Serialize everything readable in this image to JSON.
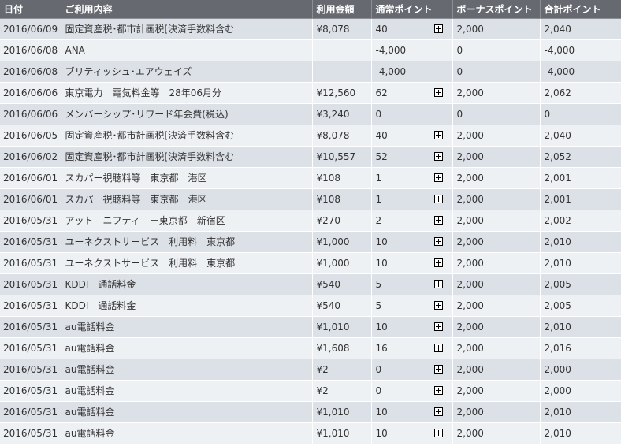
{
  "table": {
    "headers": {
      "date": "日付",
      "description": "ご利用内容",
      "amount": "利用金額",
      "regular_points": "通常ポイント",
      "bonus_points": "ボーナスポイント",
      "total_points": "合計ポイント"
    },
    "expand_icon": "plus-box-icon",
    "rows": [
      {
        "date": "2016/06/09",
        "description": "固定資産税･都市計画税[決済手数料含む",
        "amount": "¥8,078",
        "regular_points": "40",
        "expandable": true,
        "bonus_points": "2,000",
        "total_points": "2,040"
      },
      {
        "date": "2016/06/08",
        "description": "ANA",
        "amount": "",
        "regular_points": "-4,000",
        "expandable": false,
        "bonus_points": "0",
        "total_points": "-4,000"
      },
      {
        "date": "2016/06/08",
        "description": "ブリティッシュ･エアウェイズ",
        "amount": "",
        "regular_points": "-4,000",
        "expandable": false,
        "bonus_points": "0",
        "total_points": "-4,000"
      },
      {
        "date": "2016/06/06",
        "description": "東京電力　電気料金等　28年06月分",
        "amount": "¥12,560",
        "regular_points": "62",
        "expandable": true,
        "bonus_points": "2,000",
        "total_points": "2,062"
      },
      {
        "date": "2016/06/06",
        "description": "メンバーシップ･リワード年会費(税込)",
        "amount": "¥3,240",
        "regular_points": "0",
        "expandable": false,
        "bonus_points": "0",
        "total_points": "0"
      },
      {
        "date": "2016/06/05",
        "description": "固定資産税･都市計画税[決済手数料含む",
        "amount": "¥8,078",
        "regular_points": "40",
        "expandable": true,
        "bonus_points": "2,000",
        "total_points": "2,040"
      },
      {
        "date": "2016/06/02",
        "description": "固定資産税･都市計画税[決済手数料含む",
        "amount": "¥10,557",
        "regular_points": "52",
        "expandable": true,
        "bonus_points": "2,000",
        "total_points": "2,052"
      },
      {
        "date": "2016/06/01",
        "description": "スカパー視聴料等　東京都　港区",
        "amount": "¥108",
        "regular_points": "1",
        "expandable": true,
        "bonus_points": "2,000",
        "total_points": "2,001"
      },
      {
        "date": "2016/06/01",
        "description": "スカパー視聴料等　東京都　港区",
        "amount": "¥108",
        "regular_points": "1",
        "expandable": true,
        "bonus_points": "2,000",
        "total_points": "2,001"
      },
      {
        "date": "2016/05/31",
        "description": "アット　ニフティ　－東京都　新宿区",
        "amount": "¥270",
        "regular_points": "2",
        "expandable": true,
        "bonus_points": "2,000",
        "total_points": "2,002"
      },
      {
        "date": "2016/05/31",
        "description": "ユーネクストサービス　利用料　東京都",
        "amount": "¥1,000",
        "regular_points": "10",
        "expandable": true,
        "bonus_points": "2,000",
        "total_points": "2,010"
      },
      {
        "date": "2016/05/31",
        "description": "ユーネクストサービス　利用料　東京都",
        "amount": "¥1,000",
        "regular_points": "10",
        "expandable": true,
        "bonus_points": "2,000",
        "total_points": "2,010"
      },
      {
        "date": "2016/05/31",
        "description": "KDDI　通話料金",
        "amount": "¥540",
        "regular_points": "5",
        "expandable": true,
        "bonus_points": "2,000",
        "total_points": "2,005"
      },
      {
        "date": "2016/05/31",
        "description": "KDDI　通話料金",
        "amount": "¥540",
        "regular_points": "5",
        "expandable": true,
        "bonus_points": "2,000",
        "total_points": "2,005"
      },
      {
        "date": "2016/05/31",
        "description": "au電話料金",
        "amount": "¥1,010",
        "regular_points": "10",
        "expandable": true,
        "bonus_points": "2,000",
        "total_points": "2,010"
      },
      {
        "date": "2016/05/31",
        "description": "au電話料金",
        "amount": "¥1,608",
        "regular_points": "16",
        "expandable": true,
        "bonus_points": "2,000",
        "total_points": "2,016"
      },
      {
        "date": "2016/05/31",
        "description": "au電話料金",
        "amount": "¥2",
        "regular_points": "0",
        "expandable": true,
        "bonus_points": "2,000",
        "total_points": "2,000"
      },
      {
        "date": "2016/05/31",
        "description": "au電話料金",
        "amount": "¥2",
        "regular_points": "0",
        "expandable": true,
        "bonus_points": "2,000",
        "total_points": "2,000"
      },
      {
        "date": "2016/05/31",
        "description": "au電話料金",
        "amount": "¥1,010",
        "regular_points": "10",
        "expandable": true,
        "bonus_points": "2,000",
        "total_points": "2,010"
      },
      {
        "date": "2016/05/31",
        "description": "au電話料金",
        "amount": "¥1,010",
        "regular_points": "10",
        "expandable": true,
        "bonus_points": "2,000",
        "total_points": "2,010"
      }
    ]
  }
}
